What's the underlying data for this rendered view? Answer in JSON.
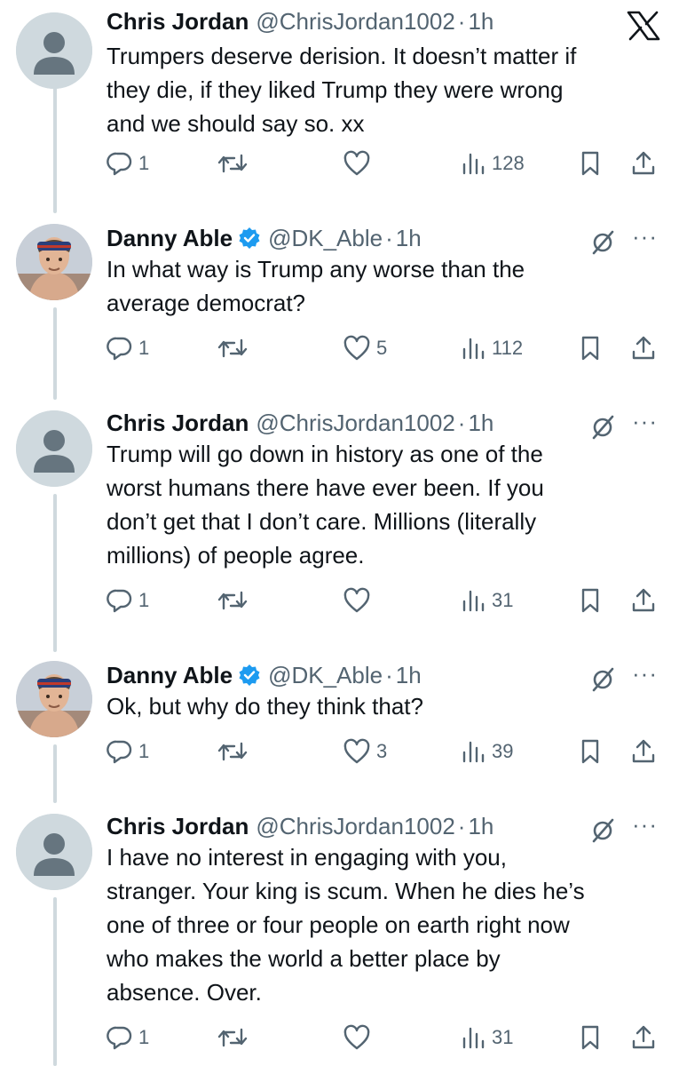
{
  "tweets": [
    {
      "name": "Chris Jordan",
      "handle": "@ChrisJordan1002",
      "time": "1h",
      "verified": false,
      "text_lines": [
        "Trumpers deserve derision. It doesn’t matter if",
        "they die, if they liked Trump they were wrong",
        "and we should say so. xx"
      ],
      "replies": "1",
      "retweets": "",
      "likes": "",
      "views": "128"
    },
    {
      "name": "Danny Able",
      "handle": "@DK_Able",
      "time": "1h",
      "verified": true,
      "text_lines": [
        "In what way is Trump any worse than the",
        "average democrat?"
      ],
      "replies": "1",
      "retweets": "",
      "likes": "5",
      "views": "112"
    },
    {
      "name": "Chris Jordan",
      "handle": "@ChrisJordan1002",
      "time": "1h",
      "verified": false,
      "text_lines": [
        "Trump will go down in history as one of the",
        "worst humans there have ever been. If you",
        "don’t get that I don’t care. Millions (literally",
        "millions) of people agree."
      ],
      "replies": "1",
      "retweets": "",
      "likes": "",
      "views": "31"
    },
    {
      "name": "Danny Able",
      "handle": "@DK_Able",
      "time": "1h",
      "verified": true,
      "text_lines": [
        "Ok, but why do they think that?"
      ],
      "replies": "1",
      "retweets": "",
      "likes": "3",
      "views": "39"
    },
    {
      "name": "Chris Jordan",
      "handle": "@ChrisJordan1002",
      "time": "1h",
      "verified": false,
      "text_lines": [
        "I have no interest in engaging with you,",
        "stranger. Your king is scum. When he dies he’s",
        "one of three or four people on earth right now",
        "who makes the world a better place by",
        "absence. Over."
      ],
      "replies": "1",
      "retweets": "",
      "likes": "",
      "views": "31"
    }
  ],
  "dot": "·",
  "more_label": "···",
  "colors": {
    "text": "#0f1419",
    "secondary": "#536471",
    "verified": "#1d9bf0",
    "thread_line": "#cfd9de"
  },
  "icons": [
    "x-logo-icon",
    "grok-icon",
    "more-icon",
    "reply-icon",
    "retweet-icon",
    "like-icon",
    "views-icon",
    "bookmark-icon",
    "share-icon",
    "verified-badge-icon"
  ]
}
